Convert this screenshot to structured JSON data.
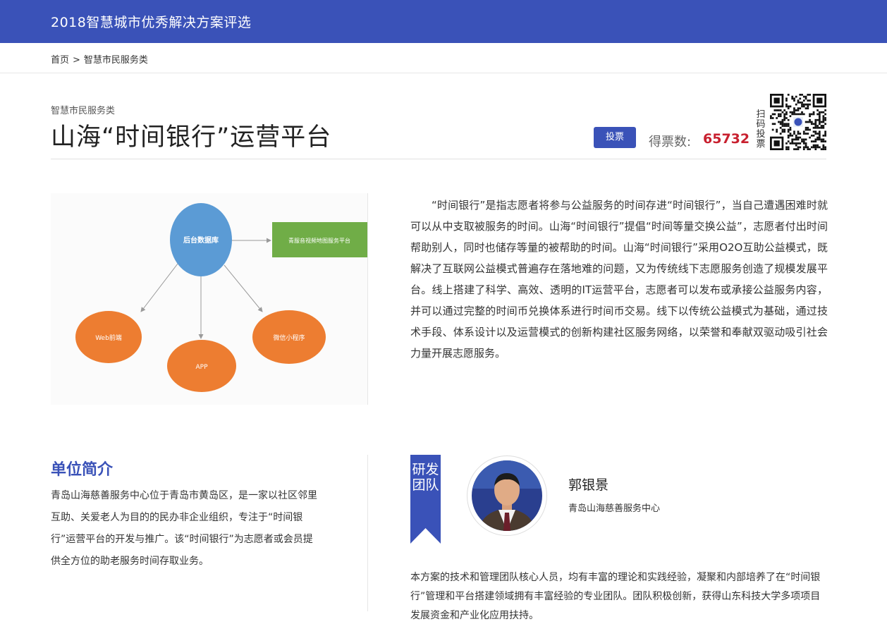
{
  "header": {
    "site_title": "2018智慧城市优秀解决方案评选"
  },
  "breadcrumb": {
    "home": "首页",
    "separator": ">",
    "current": "智慧市民服务类"
  },
  "project": {
    "category": "智慧市民服务类",
    "title": "山海“时间银行”运营平台",
    "vote_button": "投票",
    "votes_label": "得票数:",
    "votes_count": "65732",
    "scan_vote_text": "扫码投票",
    "description": "“时间银行”是指志愿者将参与公益服务的时间存进“时间银行”，当自己遭遇困难时就可以从中支取被服务的时间。山海“时间银行”提倡“时间等量交换公益”，志愿者付出时间帮助别人，同时也储存等量的被帮助的时间。山海“时间银行”采用O2O互助公益模式，既解决了互联网公益模式普遍存在落地难的问题，又为传统线下志愿服务创造了规模发展平台。线上搭建了科学、高效、透明的IT运营平台，志愿者可以发布或承接公益服务内容，并可以通过完整的时间币兑换体系进行时间币交易。线下以传统公益模式为基础，通过技术手段、体系设计以及运营模式的创新构建社区服务网络，以荣誉和奉献双驱动吸引社会力量开展志愿服务。"
  },
  "diagram": {
    "center_node": "后台数据库",
    "right_node": "青服音视频地图服务平台",
    "left_node": "Web前端",
    "bottom_node": "APP",
    "right_bottom_node": "微信小程序"
  },
  "unit": {
    "heading": "单位简介",
    "text": "青岛山海慈善服务中心位于青岛市黄岛区，是一家以社区邻里互助、关爱老人为目的的民办非企业组织，专注于“时间银行”运营平台的开发与推广。该“时间银行”为志愿者或会员提供全方位的助老服务时间存取业务。"
  },
  "team": {
    "ribbon_label": "研发团队",
    "member_name": "郭银景",
    "member_org": "青岛山海慈善服务中心",
    "text": "本方案的技术和管理团队核心人员，均有丰富的理论和实践经验，凝聚和内部培养了在“时间银行”管理和平台搭建领域拥有丰富经验的专业团队。团队积极创新，获得山东科技大学多项项目发展资金和产业化应用扶持。"
  },
  "colors": {
    "brand_blue": "#3a52b8",
    "vote_red": "#c8202f",
    "node_blue": "#5b9bd5",
    "node_orange": "#ed7d31",
    "node_green": "#70ad47"
  }
}
